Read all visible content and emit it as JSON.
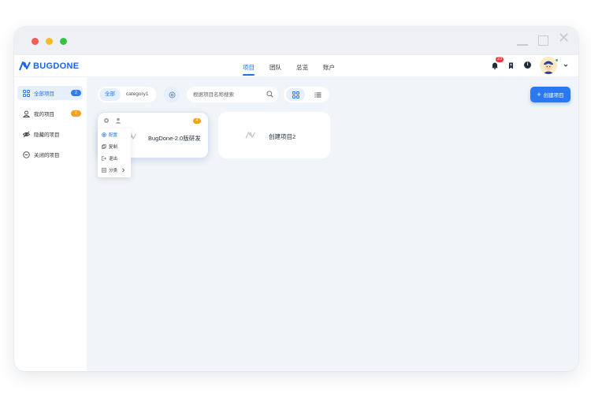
{
  "header": {
    "logo_text": "BUGDONE",
    "nav": [
      {
        "label": "项目",
        "active": true
      },
      {
        "label": "团队",
        "active": false
      },
      {
        "label": "总览",
        "active": false
      },
      {
        "label": "账户",
        "active": false
      }
    ],
    "notification_count": "23",
    "info_glyph": "i",
    "caret_icon": "chevron-down-icon"
  },
  "sidebar": {
    "items": [
      {
        "label": "全部项目",
        "badge": "2",
        "active": true,
        "icon": "grid-icon"
      },
      {
        "label": "我的项目",
        "badge": "0",
        "active": false,
        "icon": "user-icon"
      },
      {
        "label": "隐藏的项目",
        "badge": "",
        "active": false,
        "icon": "eye-off-icon"
      },
      {
        "label": "关闭的项目",
        "badge": "",
        "active": false,
        "icon": "close-circle-icon"
      }
    ]
  },
  "toolbar": {
    "filters": [
      {
        "label": "全部",
        "active": true
      },
      {
        "label": "category1",
        "active": false
      }
    ],
    "search_placeholder": "根据项目名称搜索",
    "create_label": "创建项目",
    "create_icon": "+"
  },
  "projects": [
    {
      "title": "BugDone-2.0版研发",
      "badge": "4"
    },
    {
      "title": "创建项目2",
      "badge": ""
    }
  ],
  "context_menu": {
    "items": [
      {
        "label": "配置",
        "icon": "settings-icon",
        "active": true
      },
      {
        "label": "复制",
        "icon": "copy-icon",
        "active": false
      },
      {
        "label": "退出",
        "icon": "exit-icon",
        "active": false
      },
      {
        "label": "分类",
        "icon": "category-icon",
        "active": false
      }
    ]
  },
  "colors": {
    "accent": "#1f6ff0",
    "accent_light": "#e6f0fd",
    "badge_orange": "#f6a11b",
    "badge_red": "#f0353a",
    "background": "#f1f4f8"
  }
}
